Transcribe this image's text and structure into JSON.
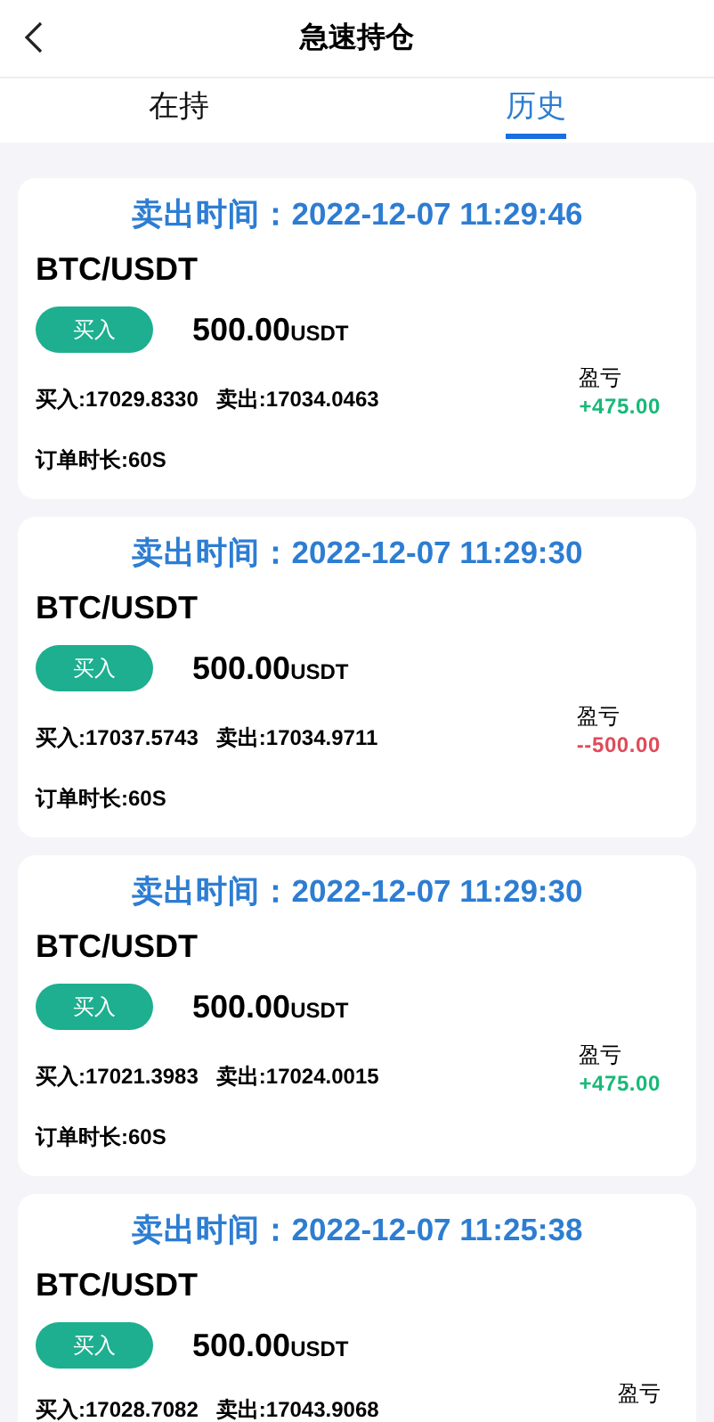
{
  "header": {
    "title": "急速持仓"
  },
  "tabs": [
    {
      "label": "在持",
      "selected": false
    },
    {
      "label": "历史",
      "selected": true
    }
  ],
  "orders": [
    {
      "sell_time": "卖出时间：2022-12-07 11:29:46",
      "pair": "BTC/USDT",
      "side": "买入",
      "amount": "500.00",
      "unit": "USDT",
      "buy_price": "买入:17029.8330",
      "sell_price": "卖出:17034.0463",
      "pnl_label": "盈亏",
      "pnl": {
        "value": "+475.00",
        "kind": "gain"
      },
      "duration": "订单时长:60S"
    },
    {
      "sell_time": "卖出时间：2022-12-07 11:29:30",
      "pair": "BTC/USDT",
      "side": "买入",
      "amount": "500.00",
      "unit": "USDT",
      "buy_price": "买入:17037.5743",
      "sell_price": "卖出:17034.9711",
      "pnl_label": "盈亏",
      "pnl": {
        "value": "--500.00",
        "kind": "loss"
      },
      "duration": "订单时长:60S"
    },
    {
      "sell_time": "卖出时间：2022-12-07 11:29:30",
      "pair": "BTC/USDT",
      "side": "买入",
      "amount": "500.00",
      "unit": "USDT",
      "buy_price": "买入:17021.3983",
      "sell_price": "卖出:17024.0015",
      "pnl_label": "盈亏",
      "pnl": {
        "value": "+475.00",
        "kind": "gain"
      },
      "duration": "订单时长:60S"
    },
    {
      "sell_time": "卖出时间：2022-12-07 11:25:38",
      "pair": "BTC/USDT",
      "side": "买入",
      "amount": "500.00",
      "unit": "USDT",
      "buy_price": "买入:17028.7082",
      "sell_price": "卖出:17043.9068",
      "pnl_label": "盈亏"
    }
  ]
}
